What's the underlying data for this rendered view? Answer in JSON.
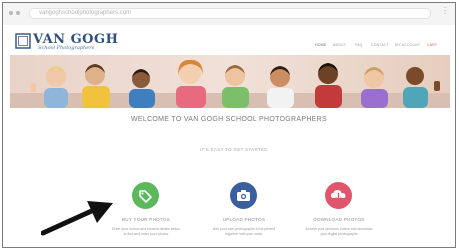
{
  "browser": {
    "address": "vangoghschoolphotographers.com"
  },
  "site": {
    "logo_title": "VAN GOGH",
    "logo_subtitle": "School Photographers"
  },
  "nav": {
    "items": [
      {
        "label": "HOME"
      },
      {
        "label": "ABOUT"
      },
      {
        "label": "FAQ"
      },
      {
        "label": "CONTACT"
      },
      {
        "label": "MY ACCOUNT"
      },
      {
        "label": "CART"
      }
    ]
  },
  "main": {
    "welcome": "WELCOME TO VAN GOGH SCHOOL PHOTOGRAPHERS",
    "get_started": "IT'S EASY TO GET STARTED"
  },
  "cards": [
    {
      "icon": "tag-icon",
      "color": "#5cb85c",
      "title": "BUY YOUR PHOTOS",
      "text": "Enter your school and student details below to find and order your photos"
    },
    {
      "icon": "camera-icon",
      "color": "#3b5e9e",
      "title": "UPLOAD PHOTOS",
      "text": "Add your own photographs to be printed together with your order"
    },
    {
      "icon": "download-icon",
      "color": "#e0556a",
      "title": "DOWNLOAD PHOTOS",
      "text": "Access your previous orders and download your digital photographs"
    }
  ],
  "colors": {
    "brand": "#2f4f7f",
    "hero_wall": "#ead2c6",
    "cart": "#d9534f"
  }
}
